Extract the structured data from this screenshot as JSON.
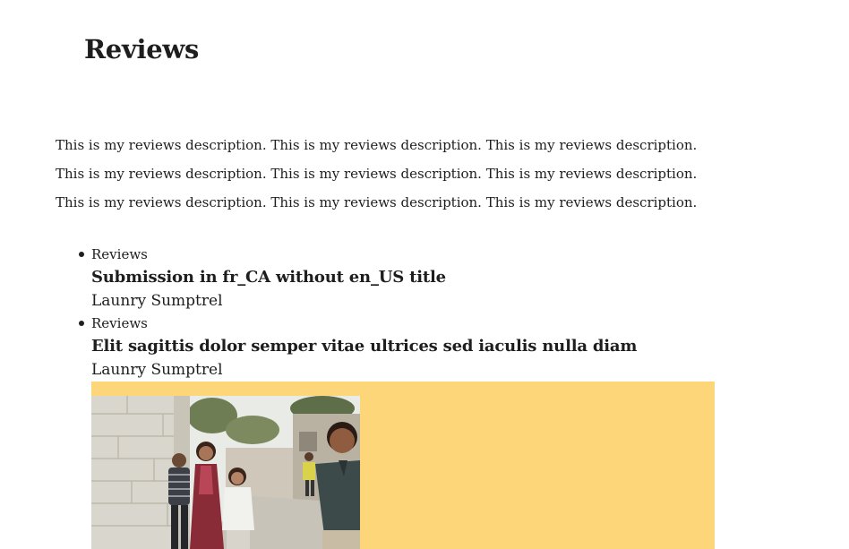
{
  "page": {
    "title": "Reviews",
    "description": "This is my reviews description. This is my reviews description. This is my reviews description. This is my reviews description. This is my reviews description. This is my reviews description. This is my reviews description. This is my reviews description. This is my reviews description."
  },
  "reviews": [
    {
      "category": "Reviews",
      "title": "Submission in fr_CA without en_US title",
      "author": "Launry Sumptrel"
    },
    {
      "category": "Reviews",
      "title": "Elit sagittis dolor semper vitae ultrices sed iaculis nulla diam",
      "author": "Launry Sumptrel"
    }
  ],
  "colors": {
    "accent_block": "#fdd679",
    "text": "#1e1e1e"
  },
  "cover": {
    "image_subject": "children-standing-by-wall-photo"
  }
}
